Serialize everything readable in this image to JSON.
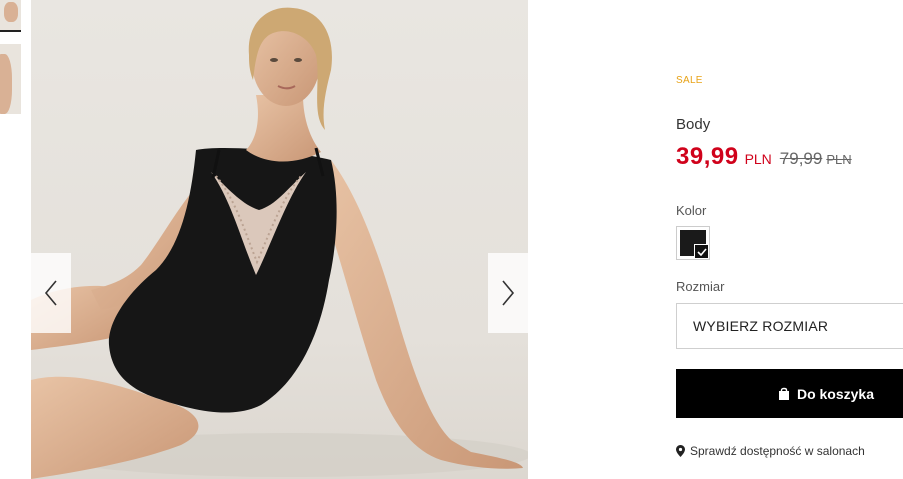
{
  "product": {
    "badge": "SALE",
    "name": "Body",
    "price_current": "39,99",
    "currency_current": "PLN",
    "price_old": "79,99",
    "currency_old": "PLN"
  },
  "options": {
    "color_label": "Kolor",
    "selected_color": "#1a1a1a",
    "size_label": "Rozmiar",
    "size_select_value": "WYBIERZ ROZMIAR"
  },
  "actions": {
    "add_to_cart_label": "Do koszyka",
    "store_availability_label": "Sprawdź dostępność w salonach"
  },
  "colors": {
    "sale": "#e8a317",
    "price": "#d0021b",
    "button_bg": "#000000"
  },
  "icons": {
    "prev": "chevron-left-icon",
    "next": "chevron-right-icon",
    "bag": "shopping-bag-icon",
    "pin": "map-pin-icon",
    "check": "check-icon"
  }
}
